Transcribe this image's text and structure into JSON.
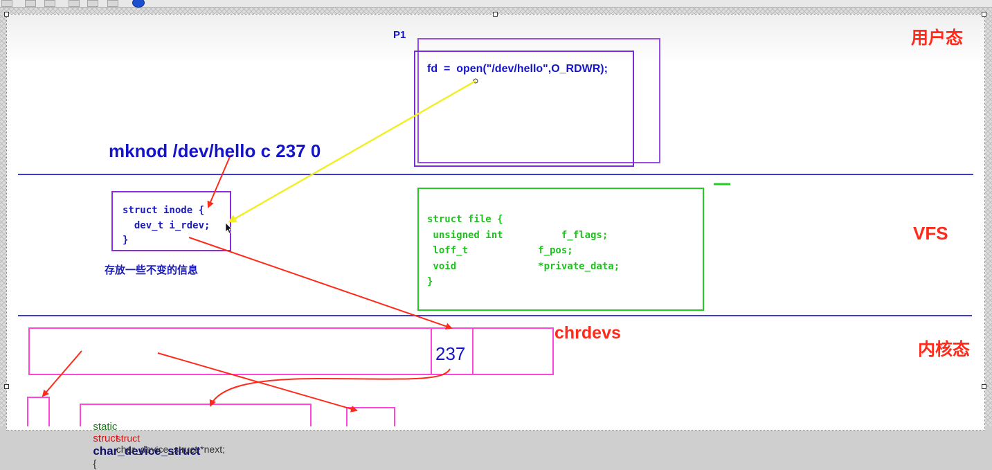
{
  "labels": {
    "user_space": "用户态",
    "vfs": "VFS",
    "kernel_space": "内核态",
    "process": "P1",
    "open_call": "fd  =  open(\"/dev/hello\",O_RDWR);",
    "mknod_cmd": "mknod /dev/hello c 237 0",
    "inode_note": "存放一些不变的信息",
    "chrdevs": "chrdevs",
    "major_number": "237"
  },
  "inode_struct": {
    "lines": [
      "struct inode {",
      "  dev_t i_rdev;",
      "}"
    ]
  },
  "file_struct": {
    "lines": [
      "struct file {",
      " unsigned int          f_flags;",
      " loff_t            f_pos;",
      " void              *private_data;",
      "}"
    ]
  },
  "char_device_struct": {
    "kw_static": "static",
    "kw_struct": "struct",
    "name": "char_device_struct",
    "brace": "{",
    "line2_kw": "struct",
    "line2_rest": "char_device_struct *next;"
  },
  "colors": {
    "user_space_label": "#ff2a1a",
    "process_box": "#8a2be2",
    "divider": "#3a3ae0",
    "inode_text": "#1b1bb8",
    "file_box": "#22cc22",
    "file_text": "#1fc21f",
    "chrdevs_box": "#ff44dd",
    "arrow_red": "#ff2a1a",
    "arrow_yellow": "#f2ef28",
    "mknod_text": "#1515c8"
  }
}
